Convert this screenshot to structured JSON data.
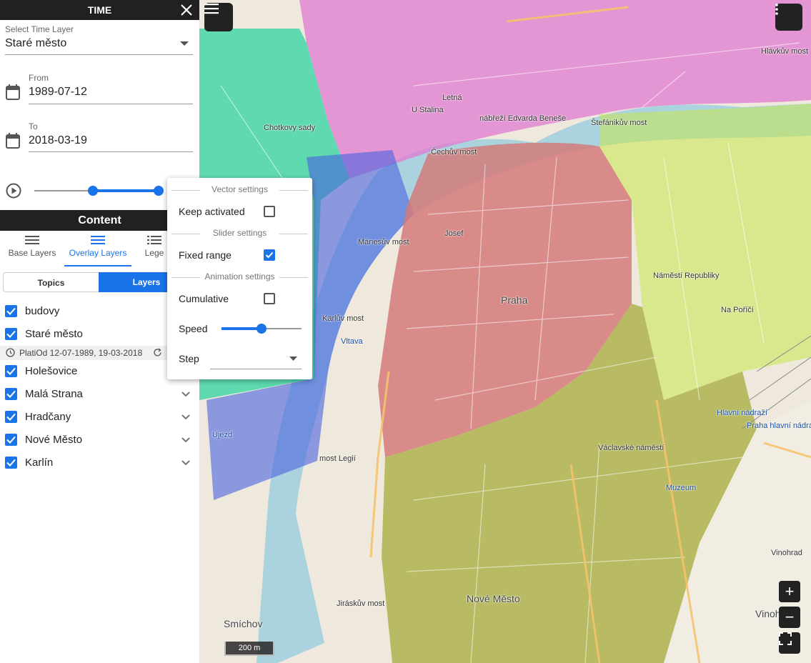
{
  "time_panel": {
    "title": "TIME",
    "layer_select_label": "Select Time Layer",
    "layer_select_value": "Staré město",
    "from_label": "From",
    "from_value": "1989-07-12",
    "to_label": "To",
    "to_value": "2018-03-19",
    "range_start_fraction": 0.47,
    "range_end_fraction": 1.0
  },
  "content_panel": {
    "title": "Content",
    "tabs": [
      {
        "label": "Base Layers"
      },
      {
        "label": "Overlay Layers"
      },
      {
        "label": "Lege"
      }
    ],
    "segments": {
      "topics": "Topics",
      "layers": "Layers"
    },
    "layers": [
      {
        "label": "budovy",
        "checked": true
      },
      {
        "label": "Staré město",
        "checked": true
      },
      {
        "label": "Holešovice",
        "checked": true
      },
      {
        "label": "Malá Strana",
        "checked": true
      },
      {
        "label": "Hradčany",
        "checked": true
      },
      {
        "label": "Nové Město",
        "checked": true
      },
      {
        "label": "Karlín",
        "checked": true
      }
    ],
    "layer_meta": "PlatiOd 12-07-1989, 19-03-2018"
  },
  "settings_popup": {
    "vector_heading": "Vector settings",
    "keep_activated_label": "Keep activated",
    "keep_activated": false,
    "slider_heading": "Slider settings",
    "fixed_range_label": "Fixed range",
    "fixed_range": true,
    "animation_heading": "Animation settings",
    "cumulative_label": "Cumulative",
    "cumulative": false,
    "speed_label": "Speed",
    "speed_fraction": 0.5,
    "step_label": "Step",
    "step_value": ""
  },
  "map": {
    "scale_label": "200 m",
    "zoom_in": "+",
    "zoom_out": "−",
    "labels": [
      "Letná",
      "Praha",
      "Štefánikův most",
      "Čechův most",
      "Mánesův most",
      "Karlův most",
      "Náměstí Republiky",
      "Václavské náměstí",
      "Nové Město",
      "Jiráskův most",
      "Smíchov",
      "Vinohrady",
      "Hlávkův most",
      "Muzeum",
      "Hlavní nádraží",
      "Praha hlavní nádraží",
      "U Stalina",
      "most Legií",
      "Vltava",
      "Josef",
      "nábřeží Edvarda Beneše",
      "Chotkovy sady",
      "Na Poříčí",
      "Újezd",
      "Vinohrad"
    ]
  },
  "colors": {
    "accent": "#1a73e8",
    "header": "#212121",
    "zone_stare_mesto": "#d47a7a",
    "zone_nove_mesto": "#a6ab3a",
    "zone_hradcany": "#2fd4a0",
    "zone_mala_strana": "#4a62e0",
    "zone_holesovice": "#e07ad0",
    "zone_karlin": "#c8e84a"
  }
}
